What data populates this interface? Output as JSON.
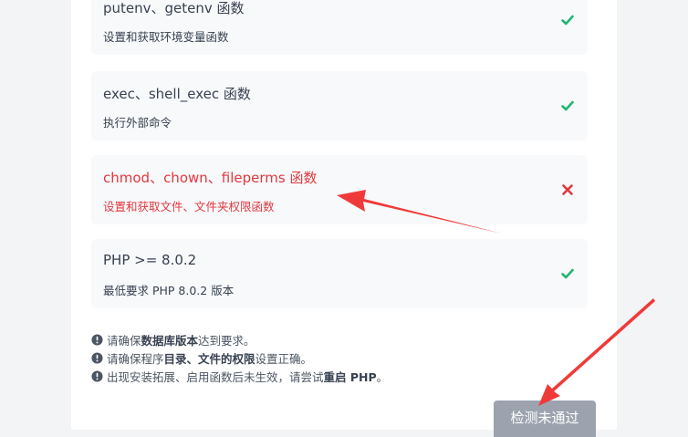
{
  "checks": [
    {
      "title": "putenv、getenv 函数",
      "desc": "设置和获取环境变量函数",
      "status": "pass",
      "icon": "check-icon"
    },
    {
      "title": "exec、shell_exec 函数",
      "desc": "执行外部命令",
      "status": "pass",
      "icon": "check-icon"
    },
    {
      "title": "chmod、chown、fileperms 函数",
      "desc": "设置和获取文件、文件夹权限函数",
      "status": "fail",
      "icon": "cross-icon"
    },
    {
      "title": "PHP >= 8.0.2",
      "desc": "最低要求 PHP 8.0.2 版本",
      "status": "pass",
      "icon": "check-icon"
    }
  ],
  "notes": [
    {
      "pre": "请确保",
      "bold": "数据库版本",
      "post": "达到要求。"
    },
    {
      "pre": "请确保程序",
      "bold": "目录、文件的权限",
      "post": "设置正确。"
    },
    {
      "pre": "出现安装拓展、启用函数后未生效，请尝试",
      "bold": "重启 PHP",
      "post": "。"
    }
  ],
  "button": {
    "label": "检测未通过"
  },
  "colors": {
    "pass": "#22b573",
    "fail": "#e0383e",
    "annotation": "#f03a3a",
    "button": "#9ca3af"
  }
}
